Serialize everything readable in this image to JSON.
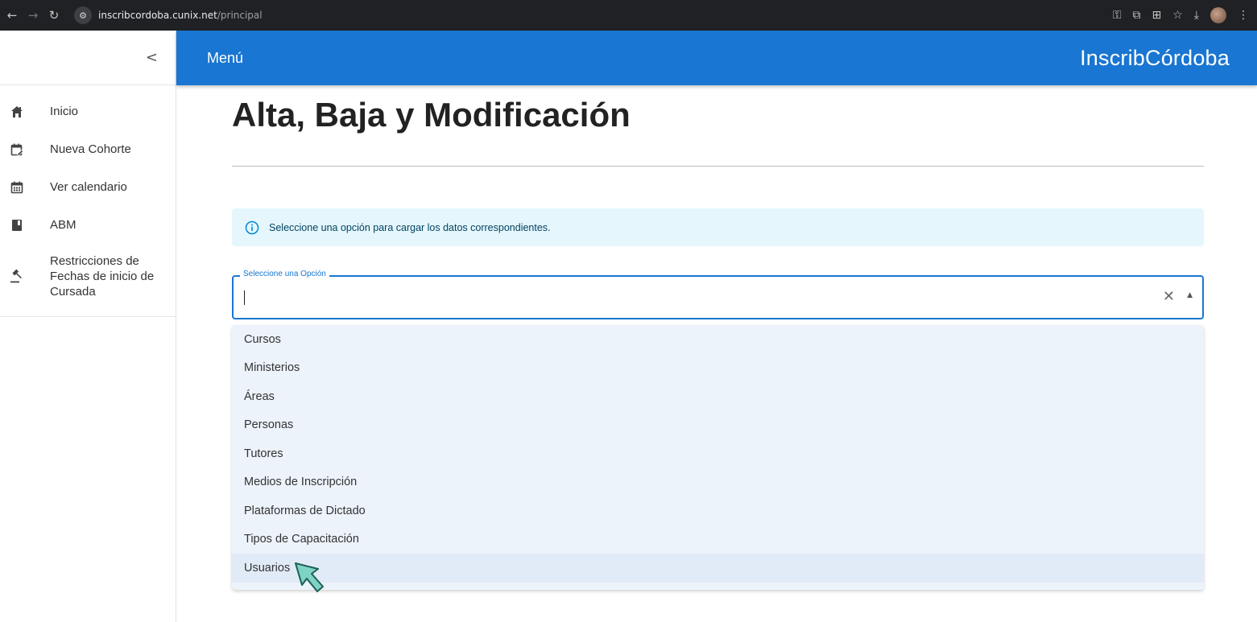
{
  "browser": {
    "url_host": "inscribcordoba.cunix.net",
    "url_path": "/principal",
    "back_icon": "arrow-left-icon",
    "forward_icon": "arrow-right-icon",
    "reload_icon": "reload-icon"
  },
  "sidebar": {
    "collapse_glyph": "<",
    "items": [
      {
        "label": "Inicio",
        "icon": "home-icon"
      },
      {
        "label": "Nueva Cohorte",
        "icon": "calendar-edit-icon"
      },
      {
        "label": "Ver calendario",
        "icon": "calendar-icon"
      },
      {
        "label": "ABM",
        "icon": "book-icon"
      },
      {
        "label": "Restricciones de Fechas de inicio de Cursada",
        "icon": "gavel-icon"
      }
    ]
  },
  "header": {
    "menu_label": "Menú",
    "brand": "InscribCórdoba",
    "color": "#1976d2"
  },
  "main": {
    "title": "Alta, Baja y Modificación",
    "alert_text": "Seleccione una opción para cargar los datos correspondientes.",
    "select": {
      "label": "Seleccione una Opción",
      "value": "",
      "clear_glyph": "✕",
      "popup_glyph": "▲"
    },
    "options": [
      "Cursos",
      "Ministerios",
      "Áreas",
      "Personas",
      "Tutores",
      "Medios de Inscripción",
      "Plataformas de Dictado",
      "Tipos de Capacitación",
      "Usuarios"
    ],
    "hovered_option": "Usuarios"
  }
}
